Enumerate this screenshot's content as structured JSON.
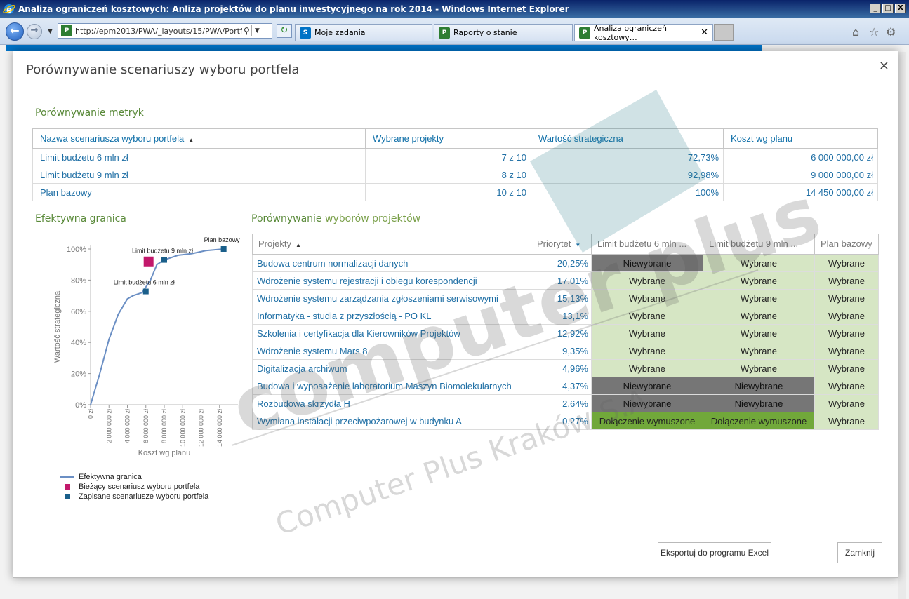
{
  "window": {
    "title": "Analiza ograniczeń kosztowych: Anliza projektów do planu inwestycyjnego na rok 2014 - Windows Internet Explorer",
    "buttons": [
      "_",
      "□",
      "X"
    ]
  },
  "browser": {
    "address": "http://epm2013/PWA/_layouts/15/PWA/PortfolioSt",
    "tabs": [
      {
        "label": "Moje zadania",
        "icon": "sharepoint-icon"
      },
      {
        "label": "Raporty o stanie",
        "icon": "project-icon"
      },
      {
        "label": "Analiza ograniczeń kosztowy…",
        "icon": "project-icon",
        "active": true
      }
    ]
  },
  "modal": {
    "title": "Porównywanie scenariuszy wyboru portfela",
    "close": "×",
    "metrics_title": "Porównywanie metryk",
    "metrics": {
      "headers": [
        "Nazwa scenariusza wyboru portfela",
        "Wybrane projekty",
        "Wartość strategiczna",
        "Koszt wg planu"
      ],
      "rows": [
        [
          "Limit budżetu 6 mln zł",
          "7 z 10",
          "72,73%",
          "6 000 000,00 zł"
        ],
        [
          "Limit budżetu 9 mln zł",
          "8 z 10",
          "92,98%",
          "9 000 000,00 zł"
        ],
        [
          "Plan bazowy",
          "10 z 10",
          "100%",
          "14 450 000,00 zł"
        ]
      ]
    },
    "frontier_title": "Efektywna granica",
    "compare_title_a": "Porównywanie ",
    "compare_title_b": "wyborów projektów",
    "compare": {
      "headers": [
        "Projekty",
        "Priorytet",
        "Limit budżetu 6 mln ...",
        "Limit budżetu 9 mln ...",
        "Plan bazowy"
      ],
      "rows": [
        [
          "Budowa centrum normalizacji danych",
          "20,25%",
          "Niewybrane",
          "Wybrane",
          "Wybrane"
        ],
        [
          "Wdrożenie systemu rejestracji i obiegu korespondencji",
          "17,01%",
          "Wybrane",
          "Wybrane",
          "Wybrane"
        ],
        [
          "Wdrożenie systemu zarządzania zgłoszeniami serwisowymi",
          "15,13%",
          "Wybrane",
          "Wybrane",
          "Wybrane"
        ],
        [
          "Informatyka - studia z przyszłością - PO KL",
          "13,1%",
          "Wybrane",
          "Wybrane",
          "Wybrane"
        ],
        [
          "Szkolenia i certyfikacja dla Kierowników Projektów",
          "12,92%",
          "Wybrane",
          "Wybrane",
          "Wybrane"
        ],
        [
          "Wdrożenie systemu Mars 8",
          "9,35%",
          "Wybrane",
          "Wybrane",
          "Wybrane"
        ],
        [
          "Digitalizacja archiwum",
          "4,96%",
          "Wybrane",
          "Wybrane",
          "Wybrane"
        ],
        [
          "Budowa i wyposażenie laboratorium Maszyn Biomolekularnych",
          "4,37%",
          "Niewybrane",
          "Niewybrane",
          "Wybrane"
        ],
        [
          "Rozbudowa skrzydła H",
          "2,64%",
          "Niewybrane",
          "Niewybrane",
          "Wybrane"
        ],
        [
          "Wymiana instalacji przeciwpożarowej w budynku A",
          "0,27%",
          "Dołączenie wymuszone",
          "Dołączenie wymuszone",
          "Wybrane"
        ]
      ]
    },
    "legend": [
      "Efektywna granica",
      "Bieżący scenariusz wyboru portfela",
      "Zapisane scenariusze wyboru portfela"
    ],
    "buttons": {
      "export": "Eksportuj do programu Excel",
      "close": "Zamknij"
    }
  },
  "colors": {
    "link": "#1f6fa5",
    "section": "#5a8a3a",
    "selected": "#d6e6c4",
    "not_selected": "#767676",
    "forced": "#71a83a",
    "current_scenario": "#c2186b",
    "saved_scenario": "#1a5f8a",
    "frontier_line": "#6b8fc4"
  },
  "watermark": {
    "main": "computer plus",
    "sub": "Computer Plus Kraków S.A."
  },
  "chart_data": {
    "type": "line",
    "title": "",
    "xlabel": "Koszt wg planu",
    "ylabel": "Wartość strategiczna",
    "xlim": [
      0,
      16000000
    ],
    "ylim": [
      0,
      100
    ],
    "x_ticks": [
      "0 zł",
      "2 000 000 zł",
      "4 000 000 zł",
      "6 000 000 zł",
      "8 000 000 zł",
      "10 000 000 zł",
      "12 000 000 zł",
      "14 000 000 zł"
    ],
    "x_tick_values": [
      0,
      2000000,
      4000000,
      6000000,
      8000000,
      10000000,
      12000000,
      14000000
    ],
    "y_ticks": [
      "0%",
      "20%",
      "40%",
      "60%",
      "80%",
      "100%"
    ],
    "y_tick_values": [
      0,
      20,
      40,
      60,
      80,
      100
    ],
    "frontier": {
      "name": "Efektywna granica",
      "x": [
        0,
        1000000,
        2000000,
        3000000,
        4000000,
        4600000,
        5600000,
        6500000,
        7200000,
        8000000,
        9500000,
        11000000,
        12500000,
        14450000
      ],
      "y": [
        0,
        20,
        42,
        58,
        68,
        70,
        72,
        80,
        90,
        93,
        96,
        97,
        99,
        100
      ]
    },
    "saved": [
      {
        "label": "Limit budżetu 6 mln zł",
        "x": 6000000,
        "y": 72.73
      },
      {
        "label": "Limit budżetu 9 mln zł",
        "x": 8000000,
        "y": 92.98
      },
      {
        "label": "Plan bazowy",
        "x": 14450000,
        "y": 100
      }
    ],
    "current": {
      "x": 6300000,
      "y": 92
    }
  }
}
